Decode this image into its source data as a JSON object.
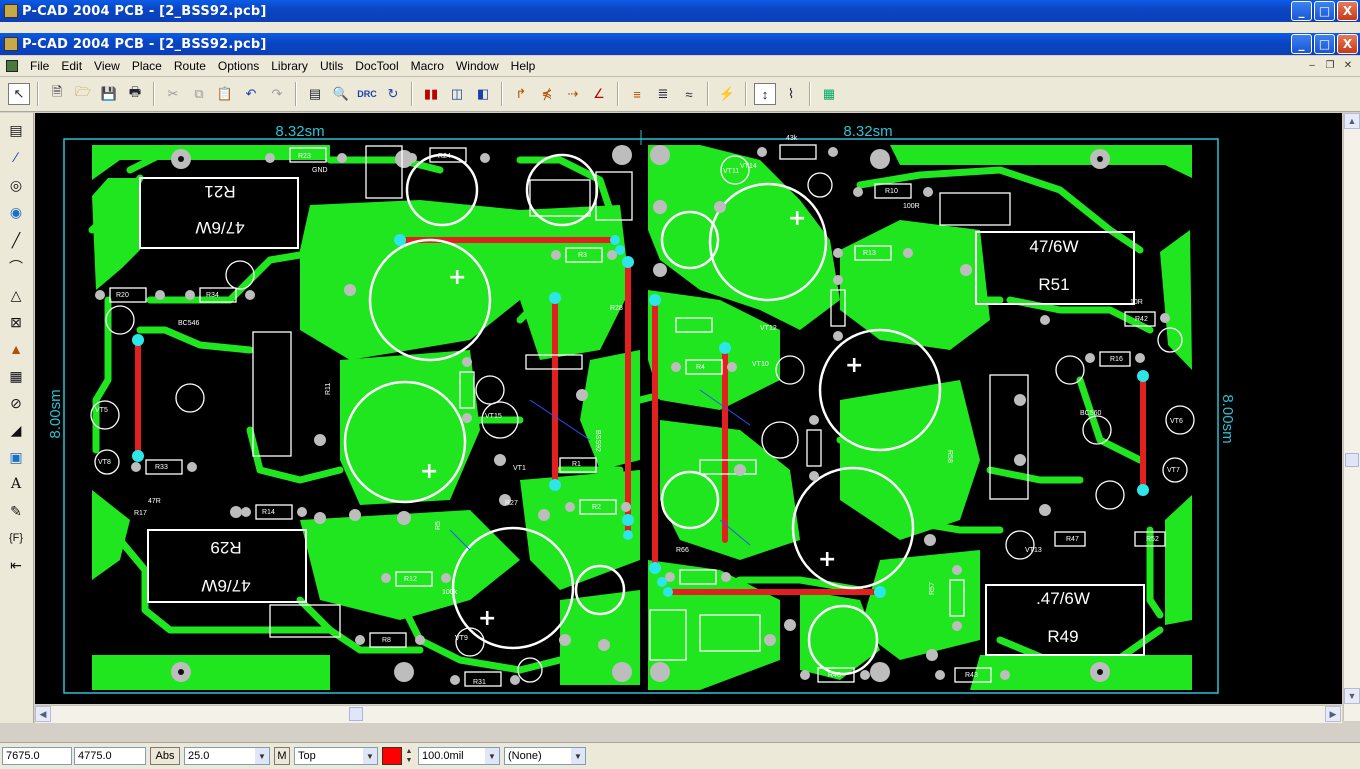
{
  "outer_window": {
    "title": "P-CAD 2004 PCB - [2_BSS92.pcb]"
  },
  "inner_window": {
    "title": "P-CAD 2004 PCB - [2_BSS92.pcb]"
  },
  "window_buttons": {
    "minimize": "_",
    "maximize": "□",
    "close": "X"
  },
  "menu": {
    "items": [
      "File",
      "Edit",
      "View",
      "Place",
      "Route",
      "Options",
      "Library",
      "Utils",
      "DocTool",
      "Macro",
      "Window",
      "Help"
    ]
  },
  "toolbar": {
    "tools": [
      "select-arrow-icon",
      "new-file-icon",
      "open-folder-icon",
      "save-icon",
      "print-icon",
      "cut-icon",
      "copy-icon",
      "paste-icon",
      "undo-icon",
      "redo-icon",
      "measure-icon",
      "zoom-icon",
      "drc-icon",
      "refresh-icon",
      "layer-toggle-icon",
      "flip-icon",
      "properties-icon",
      "route-manual-icon",
      "route-interactive-icon",
      "route-bus-icon",
      "route-miter-icon",
      "route-multi-icon",
      "route-fanout-icon",
      "route-gloss-icon",
      "route-push-icon",
      "route-lock-icon",
      "route-pattern-icon",
      "design-manager-icon"
    ]
  },
  "left_tools": [
    "select-box-icon",
    "connection-icon",
    "pad-icon",
    "via-icon",
    "line-icon",
    "arc-icon",
    "polygon-icon",
    "cutout-icon",
    "fill-icon",
    "copper-pour-icon",
    "keepout-icon",
    "point-icon",
    "component-icon",
    "text-icon",
    "attribute-icon",
    "field-icon",
    "dimension-icon"
  ],
  "pcb": {
    "dim_top_left": "8.32sm",
    "dim_top_right": "8.32sm",
    "dim_left": "8.00sm",
    "dim_right": "8.00sm",
    "resistor_labels": {
      "r21_name": "R21",
      "r21_value": "47/6W",
      "r29_name": "R29",
      "r29_value": "47/6W",
      "r51_name": "R51",
      "r51_value": "47/6W",
      "r49_name": "R49",
      "r49_value": ".47/6W"
    },
    "silk_labels": [
      "R23",
      "R24",
      "R20",
      "R34",
      "R11",
      "R14",
      "R12",
      "R8",
      "R5",
      "R1",
      "R2",
      "R27",
      "R31",
      "R4",
      "R3",
      "R13",
      "R10",
      "R42",
      "R47",
      "R52",
      "R43",
      "R46",
      "R57",
      "R66",
      "R28",
      "R17",
      "R33",
      "R58",
      "R16",
      "VT5",
      "VT6",
      "VT8",
      "VT7",
      "VT9",
      "VT1",
      "VT10",
      "VT11",
      "VT12",
      "VT13",
      "VT14",
      "VT15",
      "BC560",
      "BC546",
      "BSS92",
      "GND",
      "100R",
      "43k",
      "100k",
      "47R",
      "10R",
      "22R"
    ]
  },
  "status": {
    "x": "7675.0",
    "y": "4775.0",
    "abs": "Abs",
    "grid": "25.0",
    "m": "M",
    "layer": "Top",
    "color": "#ff0000",
    "line_width": "100.0mil",
    "net": "(None)"
  }
}
